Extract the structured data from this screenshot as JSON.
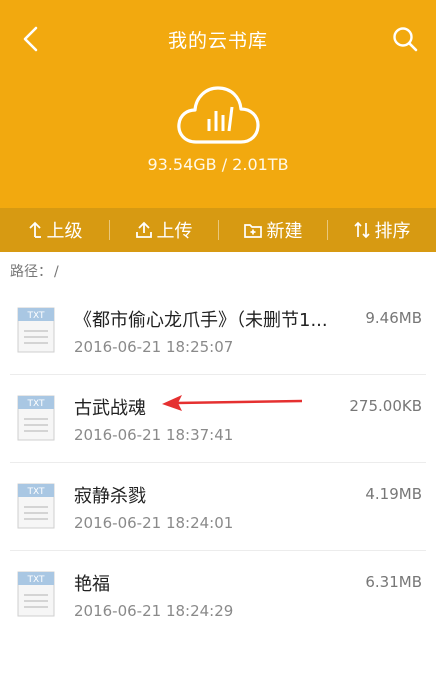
{
  "header": {
    "title": "我的云书库",
    "storage": "93.54GB / 2.01TB",
    "back_icon": "chevron-left-icon",
    "search_icon": "search-icon",
    "cloud_icon": "cloud-chart-icon",
    "bg_color": "#f2a90f"
  },
  "toolbar": {
    "items": [
      {
        "label": "上级",
        "icon": "up-arrow-icon"
      },
      {
        "label": "上传",
        "icon": "upload-icon"
      },
      {
        "label": "新建",
        "icon": "new-folder-icon"
      },
      {
        "label": "排序",
        "icon": "sort-icon"
      }
    ],
    "bg_color": "#d79a12"
  },
  "path": {
    "label": "路径：",
    "value": "/"
  },
  "files": [
    {
      "type": "TXT",
      "name": "《都市偷心龙爪手》（未删节1...",
      "date": "2016-06-21 18:25:07",
      "size": "9.46MB"
    },
    {
      "type": "TXT",
      "name": "古武战魂",
      "date": "2016-06-21 18:37:41",
      "size": "275.00KB"
    },
    {
      "type": "TXT",
      "name": "寂静杀戮",
      "date": "2016-06-21 18:24:01",
      "size": "4.19MB"
    },
    {
      "type": "TXT",
      "name": "艳福",
      "date": "2016-06-21 18:24:29",
      "size": "6.31MB"
    }
  ]
}
